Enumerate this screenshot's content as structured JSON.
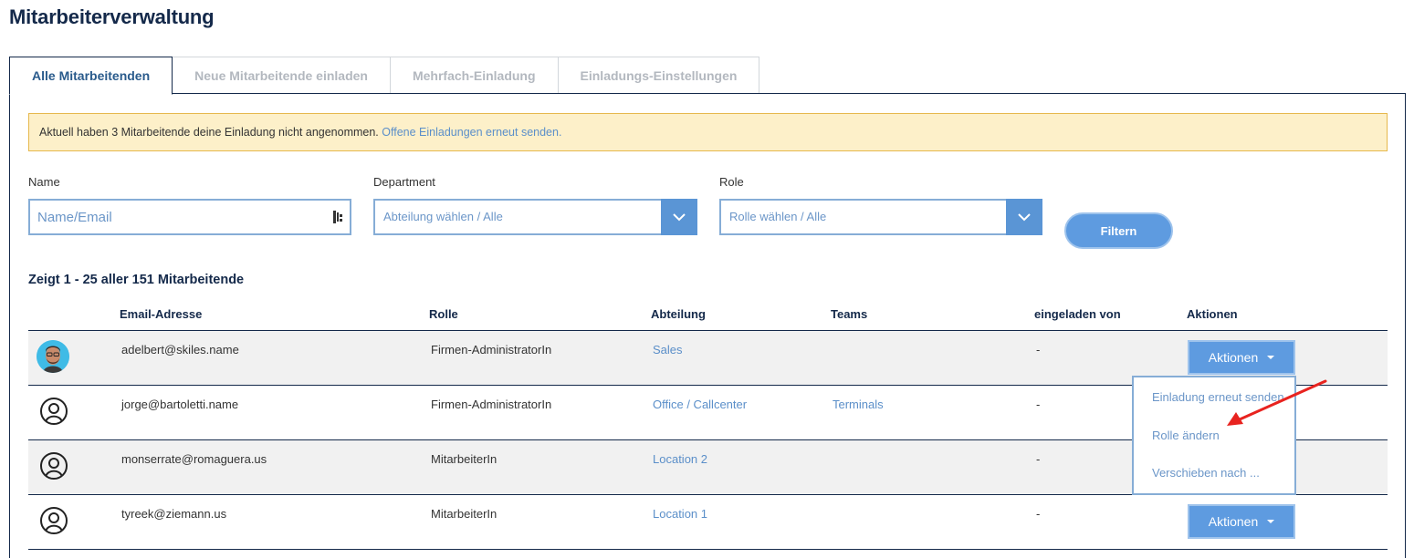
{
  "page": {
    "title": "Mitarbeiterverwaltung"
  },
  "tabs": [
    {
      "label": "Alle Mitarbeitenden",
      "active": true
    },
    {
      "label": "Neue Mitarbeitende einladen"
    },
    {
      "label": "Mehrfach-Einladung"
    },
    {
      "label": "Einladungs-Einstellungen"
    }
  ],
  "alert": {
    "text": "Aktuell haben 3 Mitarbeitende deine Einladung nicht angenommen.",
    "link": "Offene Einladungen erneut senden."
  },
  "filters": {
    "name": {
      "label": "Name",
      "placeholder": "Name/Email"
    },
    "department": {
      "label": "Department",
      "value": "Abteilung wählen / Alle"
    },
    "role": {
      "label": "Role",
      "value": "Rolle wählen / Alle"
    },
    "submit_label": "Filtern"
  },
  "results": {
    "summary": "Zeigt 1 - 25 aller 151 Mitarbeitende"
  },
  "table": {
    "headers": {
      "email": "Email-Adresse",
      "role": "Rolle",
      "department": "Abteilung",
      "teams": "Teams",
      "invited_by": "eingeladen von",
      "actions": "Aktionen"
    },
    "rows": [
      {
        "email": "adelbert@skiles.name",
        "role": "Firmen-AdministratorIn",
        "department": "Sales",
        "teams": "",
        "invited_by": "-",
        "avatar": "photo"
      },
      {
        "email": "jorge@bartoletti.name",
        "role": "Firmen-AdministratorIn",
        "department": "Office / Callcenter",
        "teams": "Terminals",
        "invited_by": "-",
        "avatar": "user-icon"
      },
      {
        "email": "monserrate@romaguera.us",
        "role": "MitarbeiterIn",
        "department": "Location 2",
        "teams": "",
        "invited_by": "-",
        "avatar": "user-icon"
      },
      {
        "email": "tyreek@ziemann.us",
        "role": "MitarbeiterIn",
        "department": "Location 1",
        "teams": "",
        "invited_by": "-",
        "avatar": "user-icon"
      }
    ],
    "action_button_label": "Aktionen"
  },
  "actions_menu": {
    "items": [
      "Einladung erneut senden",
      "Rolle ändern",
      "Verschieben nach ..."
    ]
  },
  "colors": {
    "navy": "#14294a",
    "accent_blue": "#5e9be0",
    "link_blue": "#5b8fc9",
    "alert_bg": "#fdf0c9",
    "annotation_red": "#e8231f"
  }
}
